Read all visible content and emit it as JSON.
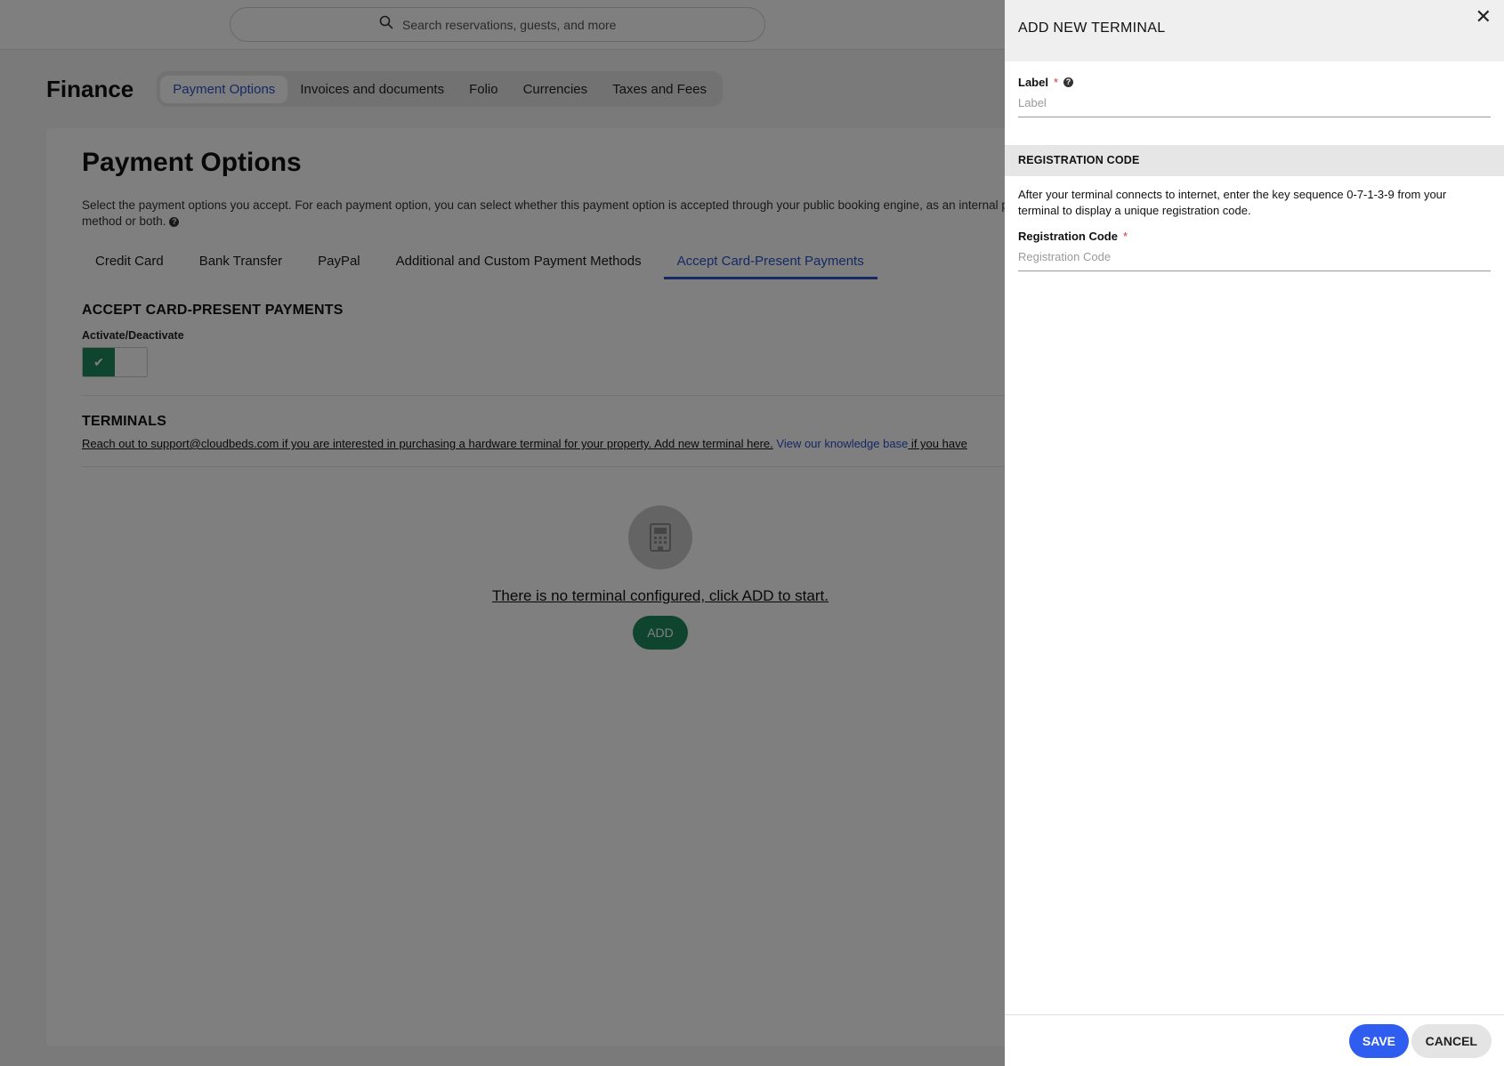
{
  "topbar": {
    "search_placeholder": "Search reservations, guests, and more"
  },
  "header": {
    "title": "Finance",
    "tabs": [
      {
        "label": "Payment Options",
        "active": true
      },
      {
        "label": "Invoices and documents"
      },
      {
        "label": "Folio"
      },
      {
        "label": "Currencies"
      },
      {
        "label": "Taxes and Fees"
      }
    ]
  },
  "main": {
    "title": "Payment Options",
    "description": "Select the payment options you accept. For each payment option, you can select whether this payment option is accepted through your public booking engine, as an internal payment method or both.",
    "sub_tabs": [
      {
        "label": "Credit Card"
      },
      {
        "label": "Bank Transfer"
      },
      {
        "label": "PayPal"
      },
      {
        "label": "Additional and Custom Payment Methods"
      },
      {
        "label": "Accept Card-Present Payments",
        "active": true
      }
    ],
    "accept_section_title": "ACCEPT CARD-PRESENT PAYMENTS",
    "toggle_label": "Activate/Deactivate",
    "toggle_on": true,
    "terminals_title": "TERMINALS",
    "terminals_note": "Reach out to support@cloudbeds.com if you are interested in purchasing a hardware terminal for your property. Add new terminal here.",
    "terminals_link": "View our knowledge base",
    "terminals_note_tail": " if you have",
    "empty_message": "There is no terminal configured, click ADD to start.",
    "add_label": "ADD"
  },
  "drawer": {
    "title": "ADD NEW TERMINAL",
    "close_glyph": "✕",
    "label_field": {
      "label": "Label",
      "placeholder": "Label"
    },
    "registration_heading": "REGISTRATION CODE",
    "registration_text": "After your terminal connects to internet, enter the key sequence 0-7-1-3-9 from your terminal to display a unique registration code.",
    "registration_field": {
      "label": "Registration Code",
      "placeholder": "Registration Code"
    },
    "save_label": "SAVE",
    "cancel_label": "CANCEL"
  },
  "colors": {
    "accent": "#2b53c7",
    "success": "#1e8a5c",
    "primary_button": "#2f5df0"
  }
}
